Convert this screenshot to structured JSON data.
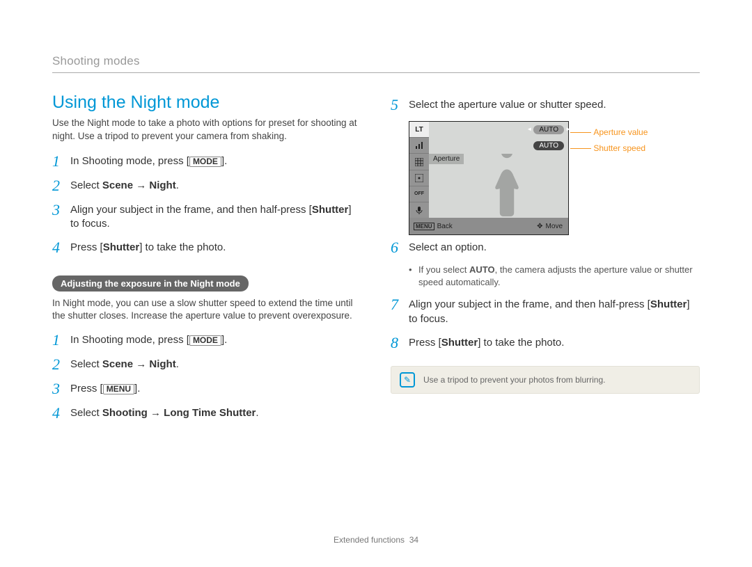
{
  "running_head": "Shooting modes",
  "section_title": "Using the Night mode",
  "intro": "Use the Night mode to take a photo with options for preset for shooting at night. Use a tripod to prevent your camera from shaking.",
  "left_steps_a": [
    {
      "n": "1",
      "pre": "In Shooting mode, press [",
      "key": "MODE",
      "post": "]."
    },
    {
      "n": "2",
      "pre": "Select ",
      "bold": "Scene → Night",
      "post": "."
    },
    {
      "n": "3",
      "pre": "Align your subject in the frame, and then half-press [",
      "bold2": "Shutter",
      "post": "] to focus."
    },
    {
      "n": "4",
      "pre": "Press [",
      "bold2": "Shutter",
      "post": "] to take the photo."
    }
  ],
  "pill_title": "Adjusting the exposure in the Night mode",
  "subintro": "In Night mode, you can use a slow shutter speed to extend the time until the shutter closes. Increase the aperture value to prevent overexposure.",
  "left_steps_b": [
    {
      "n": "1",
      "pre": "In Shooting mode, press [",
      "key": "MODE",
      "post": "]."
    },
    {
      "n": "2",
      "pre": "Select ",
      "bold": "Scene → Night",
      "post": "."
    },
    {
      "n": "3",
      "pre": "Press [",
      "key": "MENU",
      "post": "]."
    },
    {
      "n": "4",
      "pre": "Select ",
      "bold": "Shooting → Long Time Shutter",
      "post": "."
    }
  ],
  "right_steps_top": [
    {
      "n": "5",
      "txt": "Select the aperture value or shutter speed."
    }
  ],
  "lcd": {
    "lt_label": "LT",
    "auto1": "AUTO",
    "auto2": "AUTO",
    "aperture_tab": "Aperture",
    "menu": "MENU",
    "back": "Back",
    "move": "Move",
    "callout1": "Aperture value",
    "callout2": "Shutter speed"
  },
  "step6": {
    "n": "6",
    "txt": "Select an option."
  },
  "step6_note_pre": "If you select ",
  "step6_note_bold": "AUTO",
  "step6_note_post": ", the camera adjusts the aperture value or shutter speed automatically.",
  "step7": {
    "n": "7",
    "pre": "Align your subject in the frame, and then half-press [",
    "bold2": "Shutter",
    "post": "] to focus."
  },
  "step8": {
    "n": "8",
    "pre": "Press [",
    "bold2": "Shutter",
    "post": "] to take the photo."
  },
  "tip_text": "Use a tripod to prevent your photos from blurring.",
  "footer_section": "Extended functions",
  "footer_page": "34"
}
